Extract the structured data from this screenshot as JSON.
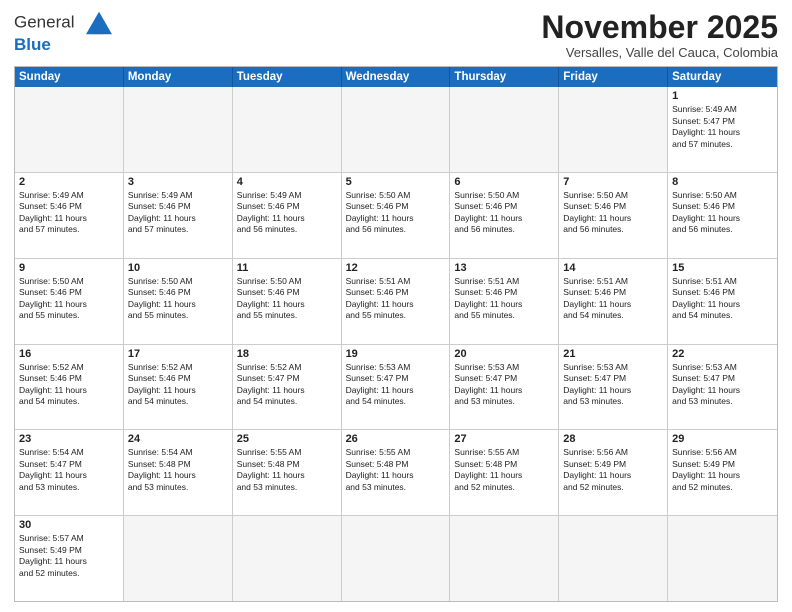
{
  "header": {
    "logo_general": "General",
    "logo_blue": "Blue",
    "month_title": "November 2025",
    "subtitle": "Versalles, Valle del Cauca, Colombia"
  },
  "weekdays": [
    "Sunday",
    "Monday",
    "Tuesday",
    "Wednesday",
    "Thursday",
    "Friday",
    "Saturday"
  ],
  "rows": [
    [
      {
        "day": "",
        "text": ""
      },
      {
        "day": "",
        "text": ""
      },
      {
        "day": "",
        "text": ""
      },
      {
        "day": "",
        "text": ""
      },
      {
        "day": "",
        "text": ""
      },
      {
        "day": "",
        "text": ""
      },
      {
        "day": "1",
        "text": "Sunrise: 5:49 AM\nSunset: 5:47 PM\nDaylight: 11 hours\nand 57 minutes."
      }
    ],
    [
      {
        "day": "2",
        "text": "Sunrise: 5:49 AM\nSunset: 5:46 PM\nDaylight: 11 hours\nand 57 minutes."
      },
      {
        "day": "3",
        "text": "Sunrise: 5:49 AM\nSunset: 5:46 PM\nDaylight: 11 hours\nand 57 minutes."
      },
      {
        "day": "4",
        "text": "Sunrise: 5:49 AM\nSunset: 5:46 PM\nDaylight: 11 hours\nand 56 minutes."
      },
      {
        "day": "5",
        "text": "Sunrise: 5:50 AM\nSunset: 5:46 PM\nDaylight: 11 hours\nand 56 minutes."
      },
      {
        "day": "6",
        "text": "Sunrise: 5:50 AM\nSunset: 5:46 PM\nDaylight: 11 hours\nand 56 minutes."
      },
      {
        "day": "7",
        "text": "Sunrise: 5:50 AM\nSunset: 5:46 PM\nDaylight: 11 hours\nand 56 minutes."
      },
      {
        "day": "8",
        "text": "Sunrise: 5:50 AM\nSunset: 5:46 PM\nDaylight: 11 hours\nand 56 minutes."
      }
    ],
    [
      {
        "day": "9",
        "text": "Sunrise: 5:50 AM\nSunset: 5:46 PM\nDaylight: 11 hours\nand 55 minutes."
      },
      {
        "day": "10",
        "text": "Sunrise: 5:50 AM\nSunset: 5:46 PM\nDaylight: 11 hours\nand 55 minutes."
      },
      {
        "day": "11",
        "text": "Sunrise: 5:50 AM\nSunset: 5:46 PM\nDaylight: 11 hours\nand 55 minutes."
      },
      {
        "day": "12",
        "text": "Sunrise: 5:51 AM\nSunset: 5:46 PM\nDaylight: 11 hours\nand 55 minutes."
      },
      {
        "day": "13",
        "text": "Sunrise: 5:51 AM\nSunset: 5:46 PM\nDaylight: 11 hours\nand 55 minutes."
      },
      {
        "day": "14",
        "text": "Sunrise: 5:51 AM\nSunset: 5:46 PM\nDaylight: 11 hours\nand 54 minutes."
      },
      {
        "day": "15",
        "text": "Sunrise: 5:51 AM\nSunset: 5:46 PM\nDaylight: 11 hours\nand 54 minutes."
      }
    ],
    [
      {
        "day": "16",
        "text": "Sunrise: 5:52 AM\nSunset: 5:46 PM\nDaylight: 11 hours\nand 54 minutes."
      },
      {
        "day": "17",
        "text": "Sunrise: 5:52 AM\nSunset: 5:46 PM\nDaylight: 11 hours\nand 54 minutes."
      },
      {
        "day": "18",
        "text": "Sunrise: 5:52 AM\nSunset: 5:47 PM\nDaylight: 11 hours\nand 54 minutes."
      },
      {
        "day": "19",
        "text": "Sunrise: 5:53 AM\nSunset: 5:47 PM\nDaylight: 11 hours\nand 54 minutes."
      },
      {
        "day": "20",
        "text": "Sunrise: 5:53 AM\nSunset: 5:47 PM\nDaylight: 11 hours\nand 53 minutes."
      },
      {
        "day": "21",
        "text": "Sunrise: 5:53 AM\nSunset: 5:47 PM\nDaylight: 11 hours\nand 53 minutes."
      },
      {
        "day": "22",
        "text": "Sunrise: 5:53 AM\nSunset: 5:47 PM\nDaylight: 11 hours\nand 53 minutes."
      }
    ],
    [
      {
        "day": "23",
        "text": "Sunrise: 5:54 AM\nSunset: 5:47 PM\nDaylight: 11 hours\nand 53 minutes."
      },
      {
        "day": "24",
        "text": "Sunrise: 5:54 AM\nSunset: 5:48 PM\nDaylight: 11 hours\nand 53 minutes."
      },
      {
        "day": "25",
        "text": "Sunrise: 5:55 AM\nSunset: 5:48 PM\nDaylight: 11 hours\nand 53 minutes."
      },
      {
        "day": "26",
        "text": "Sunrise: 5:55 AM\nSunset: 5:48 PM\nDaylight: 11 hours\nand 53 minutes."
      },
      {
        "day": "27",
        "text": "Sunrise: 5:55 AM\nSunset: 5:48 PM\nDaylight: 11 hours\nand 52 minutes."
      },
      {
        "day": "28",
        "text": "Sunrise: 5:56 AM\nSunset: 5:49 PM\nDaylight: 11 hours\nand 52 minutes."
      },
      {
        "day": "29",
        "text": "Sunrise: 5:56 AM\nSunset: 5:49 PM\nDaylight: 11 hours\nand 52 minutes."
      }
    ],
    [
      {
        "day": "30",
        "text": "Sunrise: 5:57 AM\nSunset: 5:49 PM\nDaylight: 11 hours\nand 52 minutes."
      },
      {
        "day": "",
        "text": ""
      },
      {
        "day": "",
        "text": ""
      },
      {
        "day": "",
        "text": ""
      },
      {
        "day": "",
        "text": ""
      },
      {
        "day": "",
        "text": ""
      },
      {
        "day": "",
        "text": ""
      }
    ]
  ]
}
